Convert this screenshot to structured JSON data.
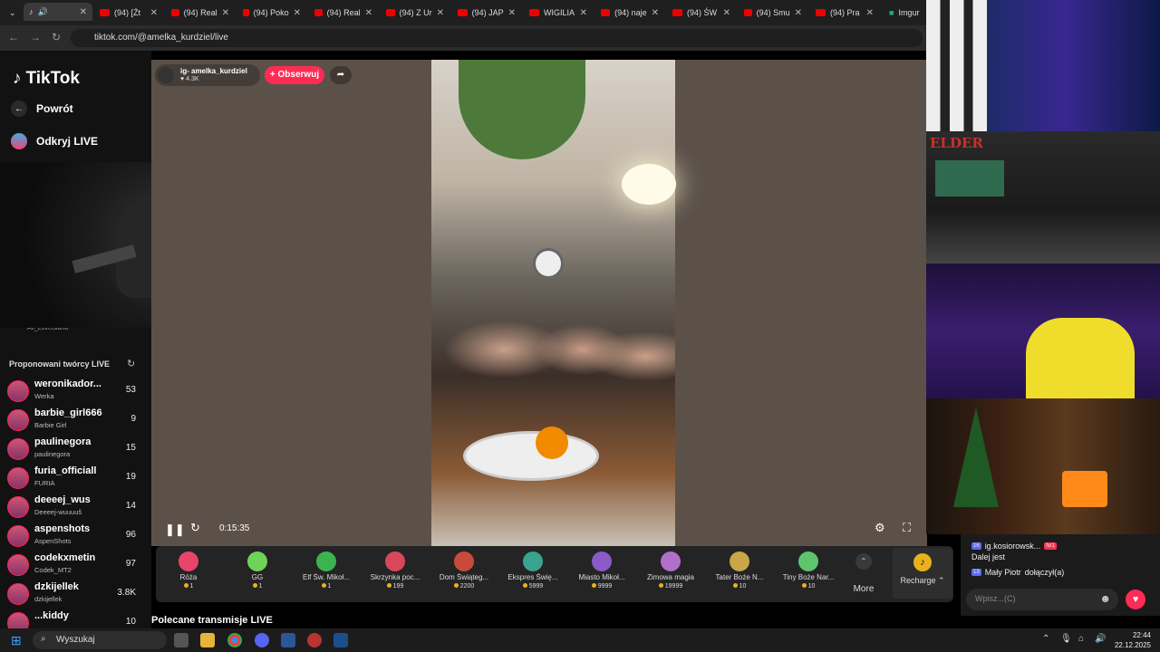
{
  "browser": {
    "tabs": [
      {
        "label": "(94) [Źt"
      },
      {
        "label": "(94) Real"
      },
      {
        "label": "(94) Poko"
      },
      {
        "label": "(94) Real"
      },
      {
        "label": "(94) Z Ur"
      },
      {
        "label": "(94) JAP"
      },
      {
        "label": "WIGILIA"
      },
      {
        "label": "(94) naje"
      },
      {
        "label": "(94) ŚW"
      },
      {
        "label": "(94) Smu"
      },
      {
        "label": "(94) Pra"
      },
      {
        "label": "Imgur"
      }
    ],
    "url": "tiktok.com/@amelka_kurdziel/live"
  },
  "sidebar": {
    "logo": "TikTok",
    "back_label": "Powrót",
    "discover_label": "Odkryj LIVE",
    "partial_text": "Ail_Lovelsland",
    "suggested_title": "Proponowani twórcy LIVE",
    "creators": [
      {
        "name": "weronikador...",
        "sub": "Werka",
        "count": "53"
      },
      {
        "name": "barbie_girl666",
        "sub": "Barbie Girl",
        "count": "9"
      },
      {
        "name": "paulinegora",
        "sub": "paulinegora",
        "count": "15"
      },
      {
        "name": "furia_officiall",
        "sub": "FURIA",
        "count": "19"
      },
      {
        "name": "deeeej_wus",
        "sub": "Deeeej-wuuuuš",
        "count": "14"
      },
      {
        "name": "aspenshots",
        "sub": "AspenShots",
        "count": "96"
      },
      {
        "name": "codekxmetin",
        "sub": "Codek_MT2",
        "count": "97"
      },
      {
        "name": "dzkijellek",
        "sub": "dzkijellek",
        "count": "3.8K"
      },
      {
        "name": "...kiddy",
        "sub": "",
        "count": "10"
      }
    ]
  },
  "live": {
    "host": "ig- amelka_kurdziel",
    "likes": "4.3K",
    "follow_label": "+ Obserwuj",
    "timer": "0:15:35"
  },
  "gifts": [
    {
      "name": "Róża",
      "price": "1",
      "color": "#e8456a"
    },
    {
      "name": "GG",
      "price": "1",
      "color": "#6fd35a"
    },
    {
      "name": "Elf Św. Mikoł...",
      "price": "1",
      "color": "#3db34f"
    },
    {
      "name": "Skrzynka poc...",
      "price": "199",
      "color": "#d9475a"
    },
    {
      "name": "Dom Świąteg...",
      "price": "2200",
      "color": "#c84b3a"
    },
    {
      "name": "Ekspres Świę...",
      "price": "5999",
      "color": "#3aa38f"
    },
    {
      "name": "Miasto Mikoł...",
      "price": "9999",
      "color": "#8a5ac8"
    },
    {
      "name": "Zimowa magia",
      "price": "19999",
      "color": "#b26fc9"
    },
    {
      "name": "Tater Boże N...",
      "price": "10",
      "color": "#c9a64a"
    },
    {
      "name": "Tiny Boże Nar...",
      "price": "10",
      "color": "#5ec46d"
    }
  ],
  "more_label": "More",
  "recharge_label": "Recharge",
  "recommended_title": "Polecane transmisje LIVE",
  "overlays": {
    "elder_label": "ELDER"
  },
  "chat": {
    "messages": [
      {
        "level": "16",
        "user": "ig.kosiorowsk...",
        "badge": "Nr1",
        "text": "Dalej jest"
      },
      {
        "level": "13",
        "user": "Mały Piotr",
        "text": "dołączył(a)"
      }
    ],
    "input_placeholder": "Wpisz...(C)"
  },
  "taskbar": {
    "search_placeholder": "Wyszukaj",
    "time": "22:44",
    "date": "22.12.2025"
  }
}
